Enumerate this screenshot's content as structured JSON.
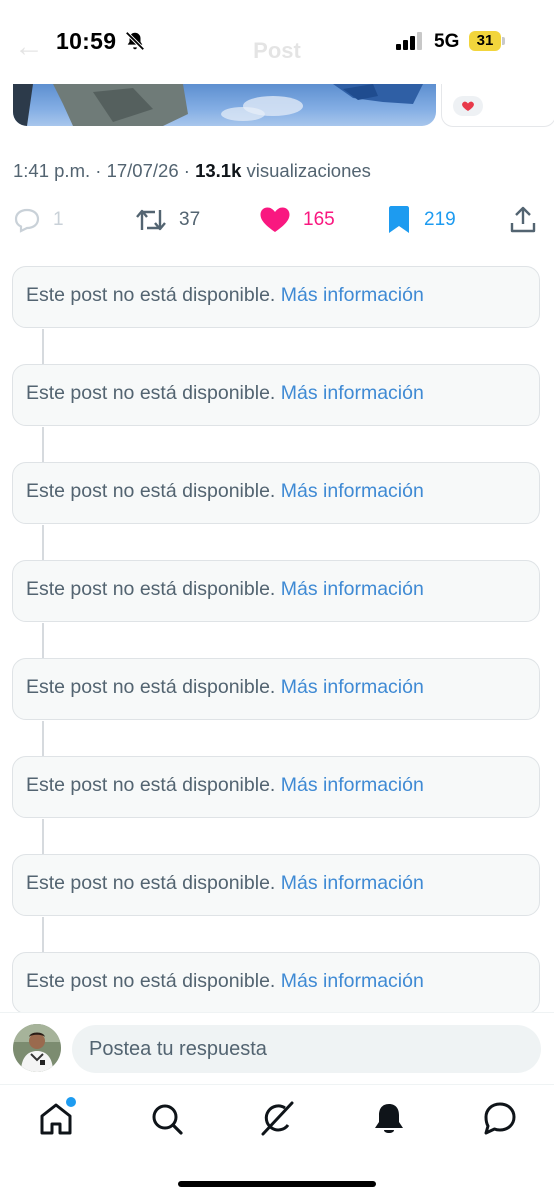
{
  "status_bar": {
    "time": "10:59",
    "network": "5G",
    "battery": "31"
  },
  "header": {
    "back": "←",
    "title": "Post"
  },
  "post": {
    "time": "1:41 p.m.",
    "separator": " · ",
    "date": "17/07/26",
    "views_count": "13.1k",
    "views_label": "visualizaciones"
  },
  "actions": {
    "replies": "1",
    "reposts": "37",
    "likes": "165",
    "bookmarks": "219",
    "like_color": "#f91880",
    "bookmark_color": "#1d9bf0"
  },
  "unavailable_posts": [
    {
      "text": "Este post no está disponible.",
      "link": "Más información"
    },
    {
      "text": "Este post no está disponible.",
      "link": "Más información"
    },
    {
      "text": "Este post no está disponible.",
      "link": "Más información"
    },
    {
      "text": "Este post no está disponible.",
      "link": "Más información"
    },
    {
      "text": "Este post no está disponible.",
      "link": "Más información"
    },
    {
      "text": "Este post no está disponible.",
      "link": "Más información"
    },
    {
      "text": "Este post no está disponible.",
      "link": "Más información"
    },
    {
      "text": "Este post no está disponible.",
      "link": "Más información"
    }
  ],
  "reply": {
    "placeholder": "Postea tu respuesta"
  },
  "nav": {
    "items": [
      "home-icon",
      "search-icon",
      "grok-icon",
      "notifications-icon",
      "messages-icon"
    ]
  }
}
